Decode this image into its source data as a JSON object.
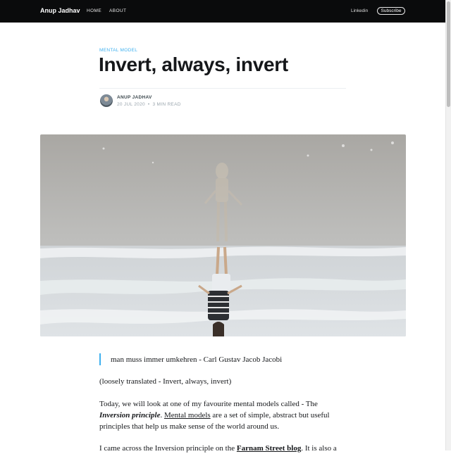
{
  "nav": {
    "brand": "Anup Jadhav",
    "home": "HOME",
    "about": "ABOUT",
    "linkedin": "Linkedin",
    "subscribe": "Subscribe"
  },
  "post": {
    "tag": "MENTAL MODEL",
    "title": "Invert, always, invert",
    "author": "ANUP JADHAV",
    "date": "20 JUL 2020",
    "separator": "•",
    "read_time": "3 MIN READ"
  },
  "content": {
    "quote": "man muss immer umkehren - Carl Gustav Jacob Jacobi",
    "translation": "(loosely translated - Invert, always, invert)",
    "p1_a": "Today, we will look at one of my favourite mental models called - The ",
    "p1_bold": "Inversion principle",
    "p1_b": ". ",
    "p1_link": "Mental models",
    "p1_c": " are a set of simple, abstract but useful principles that help us make sense of the world around us.",
    "p2_a": "I came across the Inversion principle on the ",
    "p2_link": "Farnam Street blog",
    "p2_b": ". It is also a"
  },
  "colors": {
    "accent": "#3eb0ef",
    "topbar": "#0a0b0c"
  }
}
